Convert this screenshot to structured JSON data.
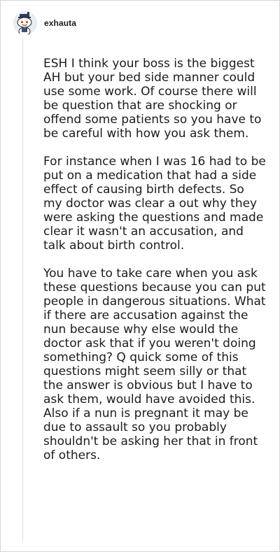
{
  "comment": {
    "author": "exhauta",
    "avatar_icon": "snoo-avatar-icon",
    "paragraphs": [
      "ESH I think your boss is the biggest AH but your bed side manner could use some work. Of course there will be question that are shocking or offend some patients so you have to be careful with how you ask them.",
      "For instance when I was 16 had to be put on a medication that had a side effect of causing birth defects. So my doctor was clear a out why they were asking the questions and made clear it wasn't an accusation, and talk about birth control.",
      "You have to take care when you ask these questions because you can put people in dangerous situations. What if there are accusation against the nun because why else would the doctor ask that if you weren't doing something? Q quick some of this questions might seem silly or that the answer is obvious but I have to ask them, would have avoided this. Also if a nun is pregnant it may be due to assault so you probably shouldn't be asking her that in front of others."
    ]
  },
  "colors": {
    "text": "#1c1c1c",
    "thread_line": "#dcdcdc",
    "border": "#d6d6d6"
  }
}
